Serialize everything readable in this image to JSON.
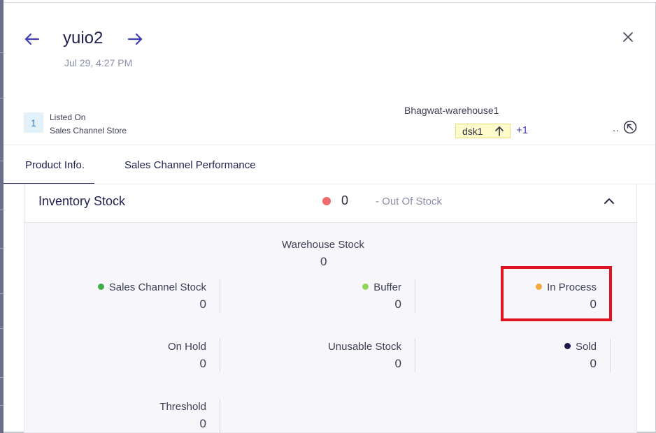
{
  "header": {
    "title": "yuio2",
    "date": "Jul 29, 4:27 PM",
    "prev_icon": "arrow-left-icon",
    "next_icon": "arrow-right-icon",
    "close_icon": "close-icon"
  },
  "listing": {
    "count": "1",
    "listed_on": "Listed On",
    "channel": "Sales Channel Store"
  },
  "warehouse": {
    "name": "Bhagwat-warehouse1",
    "sku": "dsk1",
    "more": "+1",
    "dots": "..",
    "colors": {
      "chip_bg": "#fffbcc",
      "chip_border": "#ecdf6e"
    }
  },
  "tabs": [
    {
      "label": "Product Info."
    },
    {
      "label": "Sales Channel Performance"
    }
  ],
  "inventory": {
    "title": "Inventory Stock",
    "status_count": "0",
    "status_text": "- Out Of Stock",
    "status_color": "#f06b6b",
    "warehouse_stock": {
      "label": "Warehouse Stock",
      "value": "0"
    },
    "sales_channel_stock": {
      "label": "Sales Channel Stock",
      "value": "0",
      "color": "#3fae49"
    },
    "buffer": {
      "label": "Buffer",
      "value": "0",
      "color": "#8fd65a"
    },
    "in_process": {
      "label": "In Process",
      "value": "0",
      "color": "#f4a93a"
    },
    "on_hold": {
      "label": "On Hold",
      "value": "0"
    },
    "unusable_stock": {
      "label": "Unusable Stock",
      "value": "0"
    },
    "sold": {
      "label": "Sold",
      "value": "0",
      "color": "#1a1a4a"
    },
    "threshold": {
      "label": "Threshold",
      "value": "0"
    }
  },
  "annotation": {
    "color": "#e0141f"
  }
}
